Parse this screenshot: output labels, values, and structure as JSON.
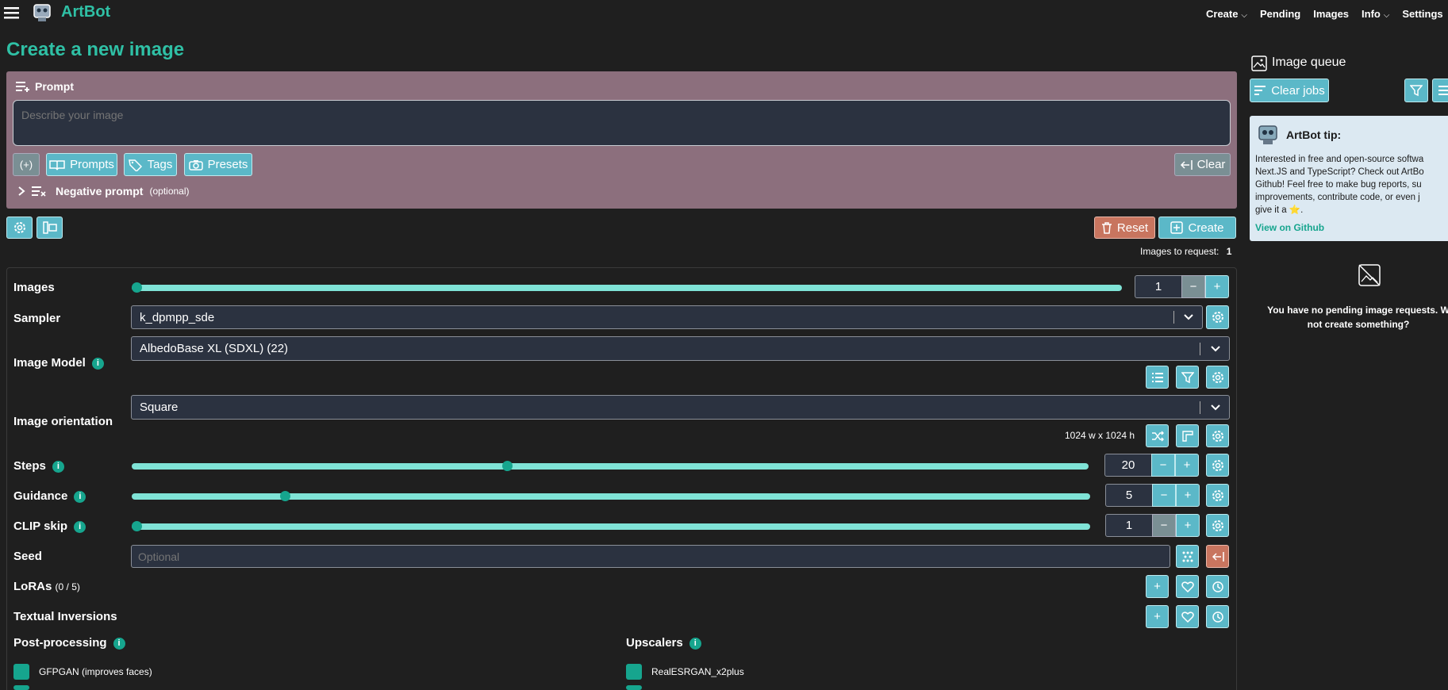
{
  "nav": {
    "brand": "ArtBot",
    "links": [
      {
        "label": "Create"
      },
      {
        "label": "Pending"
      },
      {
        "label": "Images"
      },
      {
        "label": "Info"
      },
      {
        "label": "Settings"
      }
    ]
  },
  "page": {
    "title": "Create a new image"
  },
  "prompt": {
    "label": "Prompt",
    "placeholder": "Describe your image",
    "buttons": {
      "token": "(+)",
      "prompts": "Prompts",
      "tags": "Tags",
      "presets": "Presets",
      "clear": "Clear"
    },
    "negative_label": "Negative prompt",
    "negative_hint": "(optional)"
  },
  "actions": {
    "reset": "Reset",
    "create": "Create",
    "images_to_request_label": "Images to request:",
    "images_to_request_value": "1"
  },
  "settings": {
    "images": {
      "label": "Images",
      "value": "1",
      "slider_fraction": 0
    },
    "sampler": {
      "label": "Sampler",
      "value": "k_dpmpp_sde"
    },
    "model": {
      "label": "Image Model",
      "value": "AlbedoBase XL (SDXL) (22)"
    },
    "orientation": {
      "label": "Image orientation",
      "value": "Square",
      "dims": "1024 w x 1024 h"
    },
    "steps": {
      "label": "Steps",
      "value": "20",
      "slider_fraction": 0.39
    },
    "guidance": {
      "label": "Guidance",
      "value": "5",
      "slider_fraction": 0.155
    },
    "clip": {
      "label": "CLIP skip",
      "value": "1",
      "slider_fraction": 0
    },
    "seed": {
      "label": "Seed",
      "placeholder": "Optional"
    },
    "loras": {
      "label": "LoRAs",
      "count": "(0 / 5)"
    },
    "ti": {
      "label": "Textual Inversions"
    },
    "post": {
      "label": "Post-processing",
      "items": [
        "GFPGAN (improves faces)"
      ]
    },
    "upscalers": {
      "label": "Upscalers",
      "items": [
        "RealESRGAN_x2plus"
      ]
    }
  },
  "queue": {
    "title": "Image queue",
    "clear_jobs": "Clear jobs",
    "tip_title": "ArtBot tip:",
    "tip_lines": [
      "Interested in free and open-source softwa",
      "Next.JS and TypeScript? Check out ArtBo",
      "Github! Feel free to make bug reports, su",
      "improvements, contribute code, or even j",
      "give it a ⭐."
    ],
    "tip_link": "View on Github",
    "empty_line1": "You have no pending image requests. W",
    "empty_line2": "not create something?"
  },
  "colors": {
    "accent": "#16a58e",
    "button": "#5bb8c8",
    "prompt_panel": "#8c6f7d",
    "danger": "#c8755f"
  }
}
